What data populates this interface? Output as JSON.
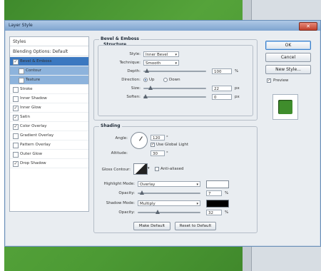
{
  "dialog": {
    "title": "Layer Style",
    "close_label": "✕"
  },
  "styles": {
    "header": "Styles",
    "blending": "Blending Options: Default",
    "items": [
      {
        "label": "Bevel & Emboss",
        "checked": true
      },
      {
        "label": "Contour",
        "checked": false
      },
      {
        "label": "Texture",
        "checked": false
      },
      {
        "label": "Stroke",
        "checked": false
      },
      {
        "label": "Inner Shadow",
        "checked": false
      },
      {
        "label": "Inner Glow",
        "checked": true
      },
      {
        "label": "Satin",
        "checked": true
      },
      {
        "label": "Color Overlay",
        "checked": true
      },
      {
        "label": "Gradient Overlay",
        "checked": false
      },
      {
        "label": "Pattern Overlay",
        "checked": false
      },
      {
        "label": "Outer Glow",
        "checked": false
      },
      {
        "label": "Drop Shadow",
        "checked": true
      }
    ]
  },
  "bevel": {
    "title": "Bevel & Emboss",
    "structure_title": "Structure",
    "style_label": "Style:",
    "style_value": "Inner Bevel",
    "technique_label": "Technique:",
    "technique_value": "Smooth",
    "depth_label": "Depth:",
    "depth_value": "100",
    "depth_unit": "%",
    "direction_label": "Direction:",
    "dir_up": "Up",
    "dir_down": "Down",
    "size_label": "Size:",
    "size_value": "22",
    "size_unit": "px",
    "soften_label": "Soften:",
    "soften_value": "0",
    "soften_unit": "px",
    "shading_title": "Shading",
    "angle_label": "Angle:",
    "angle_value": "120",
    "angle_unit": "°",
    "global_light_label": "Use Global Light",
    "altitude_label": "Altitude:",
    "altitude_value": "30",
    "altitude_unit": "°",
    "gloss_label": "Gloss Contour:",
    "anti_aliased_label": "Anti-aliased",
    "highlight_label": "Highlight Mode:",
    "highlight_value": "Overlay",
    "highlight_opacity_label": "Opacity:",
    "highlight_opacity_value": "7",
    "highlight_opacity_unit": "%",
    "shadow_label": "Shadow Mode:",
    "shadow_value": "Multiply",
    "shadow_opacity_label": "Opacity:",
    "shadow_opacity_value": "32",
    "shadow_opacity_unit": "%",
    "make_default": "Make Default",
    "reset_default": "Reset to Default"
  },
  "buttons": {
    "ok": "OK",
    "cancel": "Cancel",
    "new_style": "New Style...",
    "preview_label": "Preview"
  },
  "sliders": {
    "depth": 100,
    "size": 0.09,
    "soften": 0.0,
    "highlight_opacity": 0.07,
    "shadow_opacity": 0.32
  },
  "colors": {
    "highlight": "#ffffff",
    "shadow": "#000000",
    "preview": "#3f8d2c",
    "selection": "#3b78c0"
  }
}
